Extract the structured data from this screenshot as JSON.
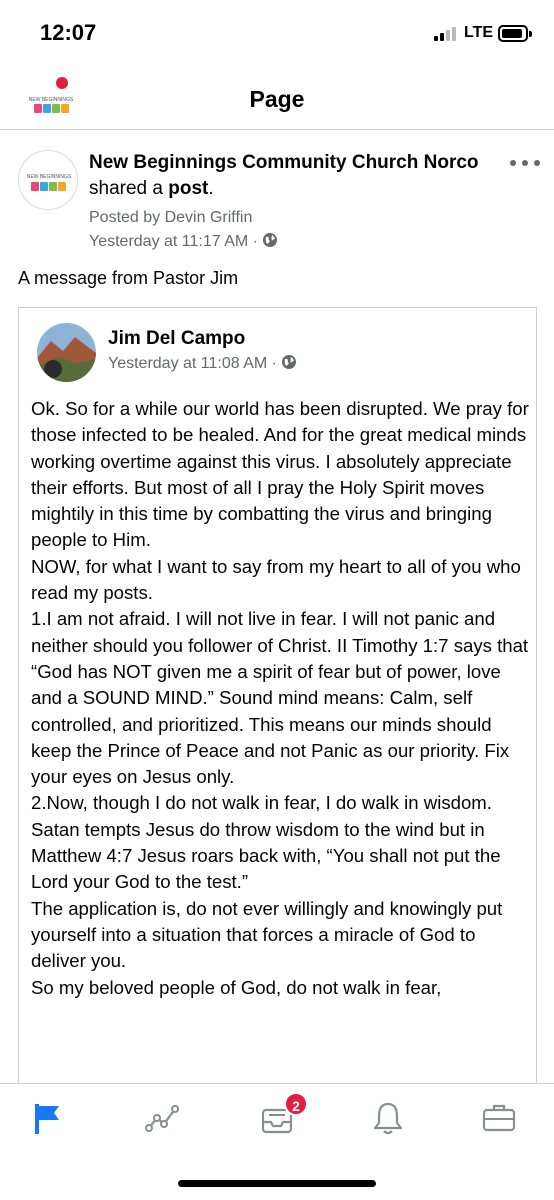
{
  "status_bar": {
    "time": "12:07",
    "network": "LTE"
  },
  "header": {
    "title": "Page",
    "logo_text": "NEW BEGINNINGS"
  },
  "post": {
    "page_name": "New Beginnings Community Church Norco",
    "action_text": "shared a",
    "action_object": "post",
    "punctuation": ".",
    "posted_by": "Posted by Devin Griffin",
    "timestamp": "Yesterday at 11:17 AM",
    "privacy_separator": "·",
    "privacy_icon": "globe-icon",
    "message": "A message from Pastor Jim"
  },
  "shared_post": {
    "author": "Jim Del Campo",
    "timestamp": "Yesterday at 11:08 AM",
    "privacy_separator": "·",
    "privacy_icon": "globe-icon",
    "paragraphs": [
      "Ok. So for a while our world has been disrupted. We pray for those infected to be healed. And for the great medical minds working overtime against this virus. I absolutely appreciate their efforts. But most of all I pray the Holy Spirit moves mightily in this time by combatting the virus and bringing people to Him.",
      "NOW, for what I want to say from my heart to all of you who read my posts.",
      "1.I am not afraid. I will not live in fear. I will not panic and neither should you follower of Christ. II Timothy 1:7 says that “God has NOT given me a spirit of fear but of power, love and a SOUND MIND.” Sound mind means: Calm, self controlled, and prioritized. This means our minds should keep the Prince of Peace and not Panic as our priority. Fix your eyes on Jesus only.",
      "2.Now, though I do not walk in fear, I do walk in wisdom. Satan tempts Jesus do throw wisdom to the wind but in Matthew 4:7 Jesus roars back with, “You shall not put the Lord your God to the test.”",
      "The application is, do not ever willingly and knowingly put yourself into a situation that forces a miracle of God to deliver you.",
      "So my beloved people of God, do not walk in fear,"
    ]
  },
  "tab_bar": {
    "tabs": [
      {
        "icon": "flag-icon",
        "active": true
      },
      {
        "icon": "insights-icon",
        "active": false
      },
      {
        "icon": "inbox-icon",
        "active": false
      },
      {
        "icon": "bell-icon",
        "active": false
      },
      {
        "icon": "briefcase-icon",
        "active": false
      }
    ],
    "inbox_badge": "2"
  },
  "colors": {
    "accent": "#1877f2",
    "secondary_text": "#65676b",
    "badge": "#e41e3f",
    "divider": "#cdd0d4",
    "icon_inactive": "#8a8d91"
  }
}
